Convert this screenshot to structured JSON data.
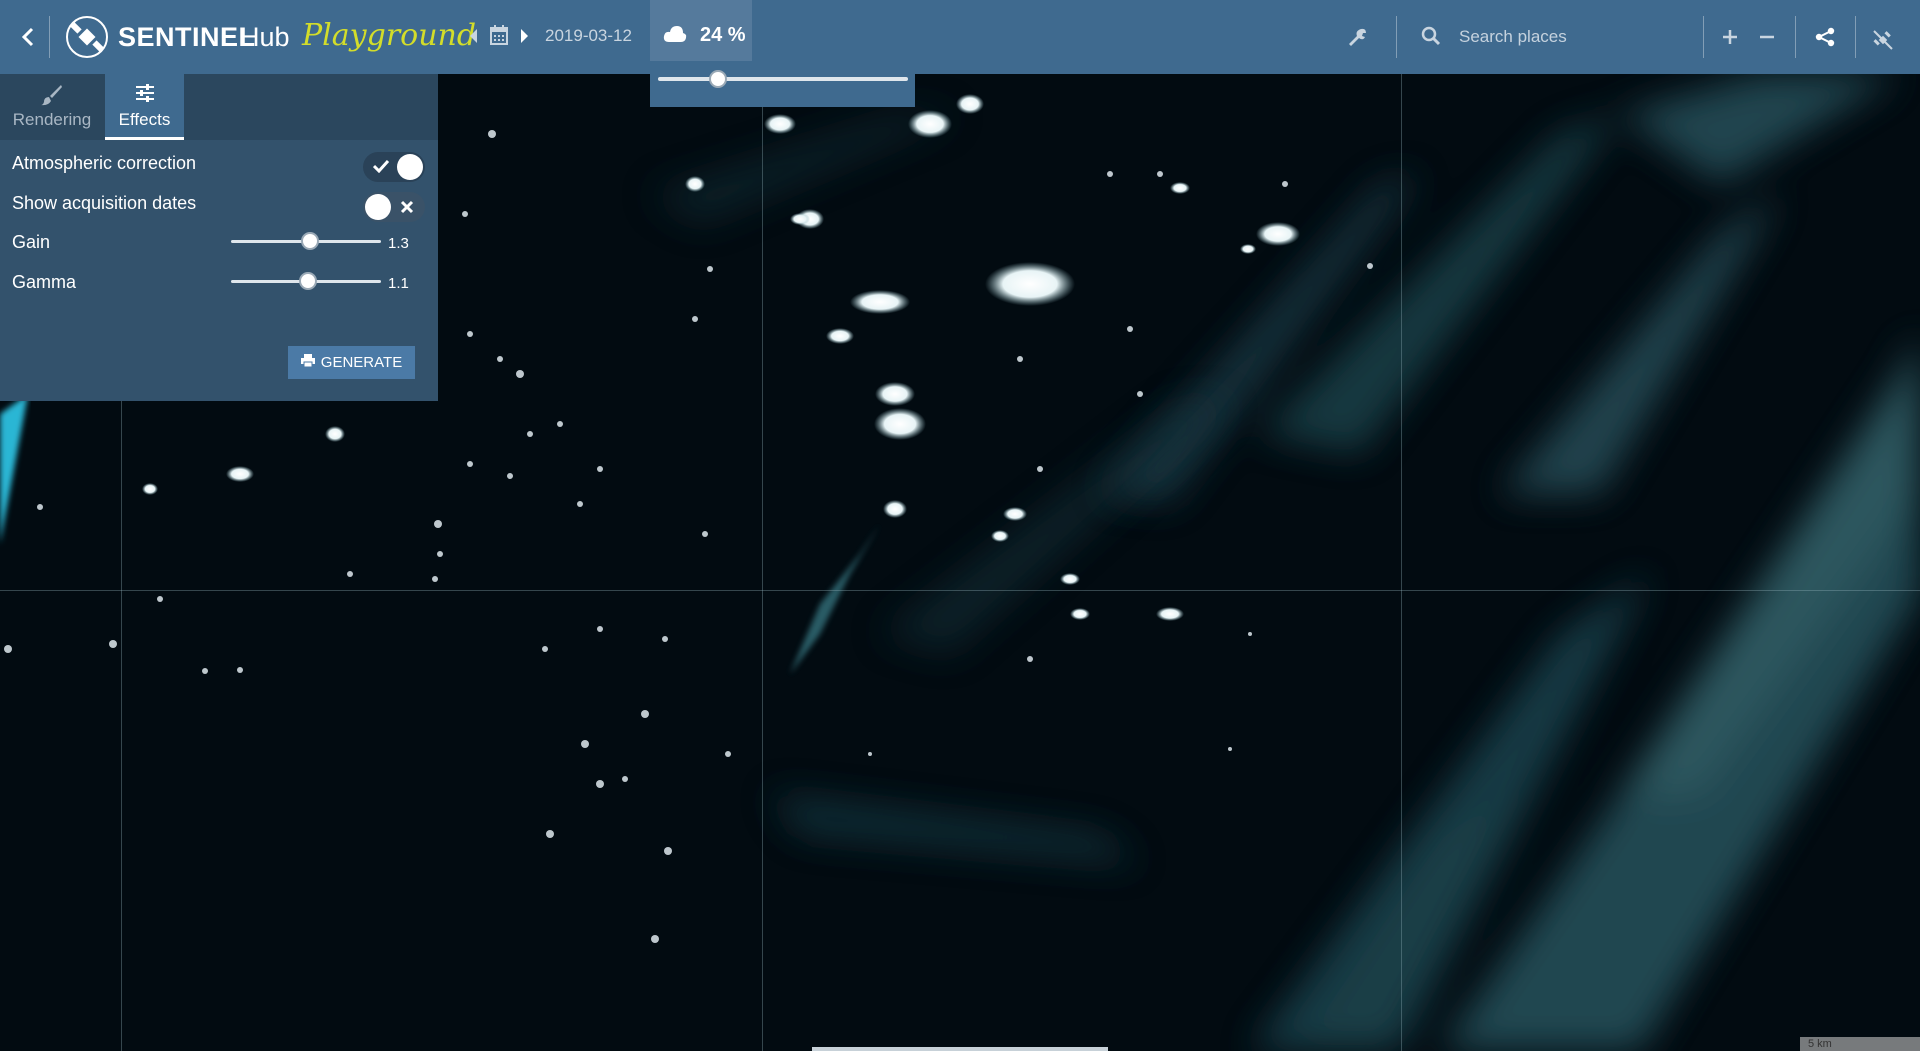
{
  "app": {
    "brand_main": "SENTINEL",
    "brand_sub": "Hub",
    "brand_tag": "Playground"
  },
  "toolbar": {
    "back_icon": "chevron-left-icon",
    "date": "2019-03-12",
    "cloud_coverage": "24 %",
    "cloud_slider_fraction": 0.24,
    "search_placeholder": "Search places",
    "icons": [
      "satellite-logo-icon",
      "calendar-icon",
      "caret-left-icon",
      "caret-right-icon",
      "cloud-icon",
      "wrench-icon",
      "search-icon",
      "plus-icon",
      "minus-icon",
      "share-icon",
      "satellite-toggle-icon"
    ]
  },
  "panel": {
    "tabs": [
      {
        "label": "Rendering",
        "icon": "brush-icon",
        "active": false
      },
      {
        "label": "Effects",
        "icon": "sliders-icon",
        "active": true
      }
    ],
    "atmospheric_correction": {
      "label": "Atmospheric correction",
      "on": true
    },
    "show_acquisition_dates": {
      "label": "Show acquisition dates",
      "on": false
    },
    "gain": {
      "label": "Gain",
      "value": "1.3"
    },
    "gamma": {
      "label": "Gamma",
      "value": "1.1"
    },
    "generate_label": "GENERATE"
  },
  "map": {
    "scale_label": "5 km"
  },
  "colors": {
    "topbar": "#3f6a8f",
    "panel": "#33526c",
    "accent_playground": "#d3dd2a",
    "map_bg": "#020a10"
  }
}
